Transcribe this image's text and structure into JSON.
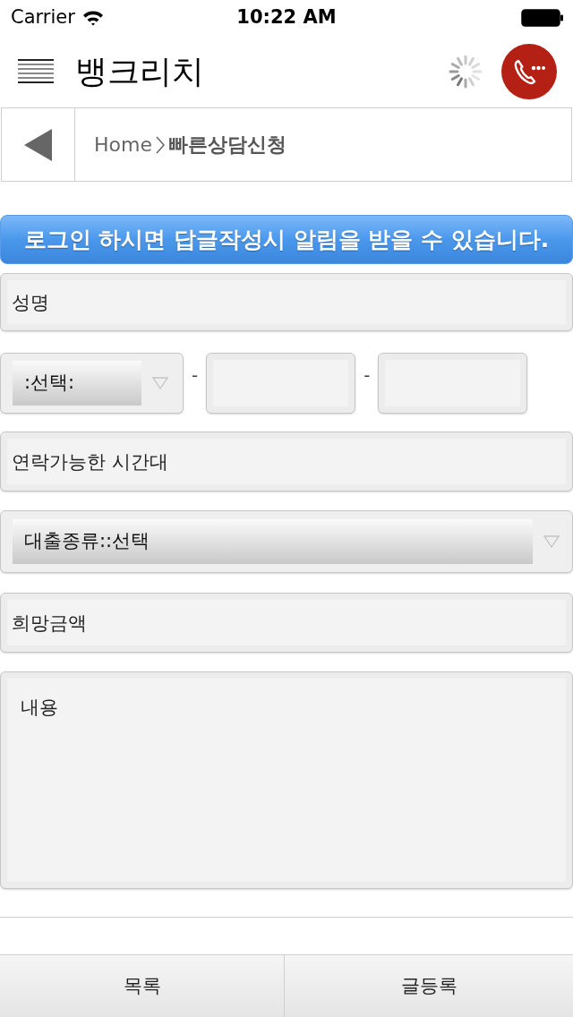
{
  "status_bar": {
    "carrier": "Carrier",
    "time": "10:22 AM"
  },
  "header": {
    "title": "뱅크리치"
  },
  "breadcrumb": {
    "home": "Home",
    "current": "빠른상담신청"
  },
  "notice": "로그인 하시면 답글작성시 알림을 받을 수 있습니다.",
  "form": {
    "fields": [
      {
        "kind": "text",
        "placeholder": "성명"
      },
      {
        "kind": "phone",
        "parts": [
          {
            "kind": "select",
            "value": ":선택:"
          },
          {
            "kind": "separator",
            "text": "-"
          },
          {
            "kind": "input"
          },
          {
            "kind": "separator",
            "text": "-"
          },
          {
            "kind": "input"
          }
        ]
      },
      {
        "kind": "text",
        "placeholder": "연락가능한 시간대"
      },
      {
        "kind": "select",
        "value": "대출종류::선택"
      },
      {
        "kind": "text",
        "placeholder": "희망금액"
      },
      {
        "kind": "textarea",
        "placeholder": "내용"
      }
    ]
  },
  "buttons": [
    {
      "label": "목록"
    },
    {
      "label": "글등록"
    }
  ]
}
